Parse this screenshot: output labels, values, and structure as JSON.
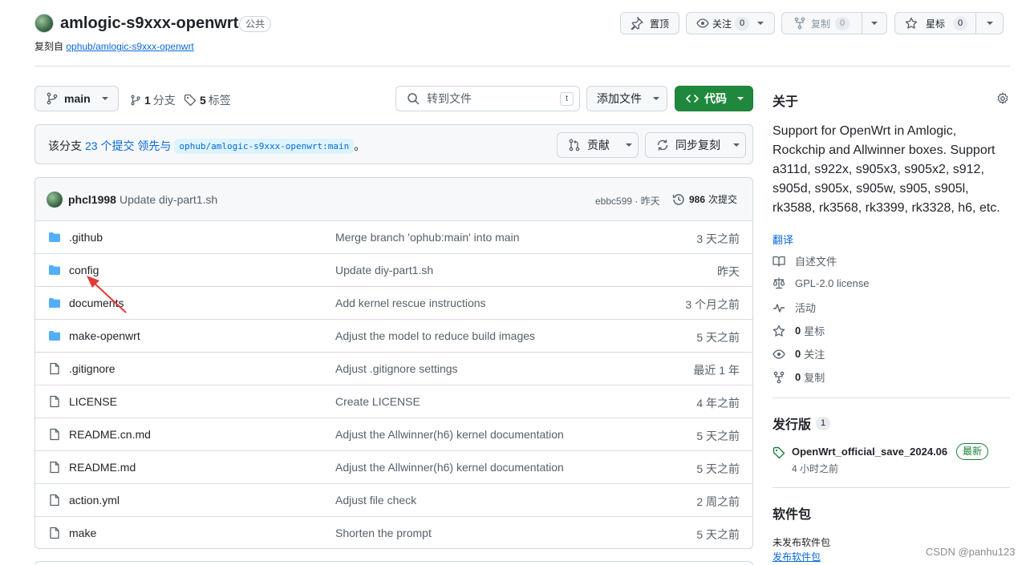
{
  "repo": {
    "name": "amlogic-s9xxx-openwrt",
    "visibility": "公共",
    "forked_prefix": "复刻自",
    "forked_from": "ophub/amlogic-s9xxx-openwrt"
  },
  "header_actions": {
    "pin_label": "置顶",
    "watch_label": "关注",
    "watch_count": "0",
    "fork_label": "复制",
    "fork_count": "0",
    "star_label": "星标",
    "star_count": "0"
  },
  "toolbar": {
    "branch": "main",
    "branches_count": "1",
    "branches_label": "分支",
    "tags_count": "5",
    "tags_label": "标签",
    "search_placeholder": "转到文件",
    "search_shortcut": "t",
    "add_file_label": "添加文件",
    "code_label": "代码"
  },
  "branch_status": {
    "prefix": "该分支",
    "ahead_link": "23 个提交 领先与",
    "upstream_ref": "ophub/amlogic-s9xxx-openwrt:main",
    "suffix": "。",
    "contribute_label": "贡献",
    "sync_label": "同步复刻"
  },
  "latest_commit": {
    "author": "phcl1998",
    "message": "Update diy-part1.sh",
    "hash_time": "ebbc599 · 昨天",
    "commits_count": "986",
    "commits_label": "次提交"
  },
  "files": [
    {
      "type": "folder",
      "name": ".github",
      "message": "Merge branch 'ophub:main' into main",
      "time": "3 天之前"
    },
    {
      "type": "folder",
      "name": "config",
      "message": "Update diy-part1.sh",
      "time": "昨天"
    },
    {
      "type": "folder",
      "name": "documents",
      "message": "Add kernel rescue instructions",
      "time": "3 个月之前"
    },
    {
      "type": "folder",
      "name": "make-openwrt",
      "message": "Adjust the model to reduce build images",
      "time": "5 天之前"
    },
    {
      "type": "file",
      "name": ".gitignore",
      "message": "Adjust .gitignore settings",
      "time": "最近 1 年"
    },
    {
      "type": "file",
      "name": "LICENSE",
      "message": "Create LICENSE",
      "time": "4 年之前"
    },
    {
      "type": "file",
      "name": "README.cn.md",
      "message": "Adjust the Allwinner(h6) kernel documentation",
      "time": "5 天之前"
    },
    {
      "type": "file",
      "name": "README.md",
      "message": "Adjust the Allwinner(h6) kernel documentation",
      "time": "5 天之前"
    },
    {
      "type": "file",
      "name": "action.yml",
      "message": "Adjust file check",
      "time": "2 周之前"
    },
    {
      "type": "file",
      "name": "make",
      "message": "Shorten the prompt",
      "time": "5 天之前"
    }
  ],
  "about": {
    "title": "关于",
    "description": "Support for OpenWrt in Amlogic, Rockchip and Allwinner boxes. Support a311d, s922x, s905x3, s905x2, s912, s905d, s905x, s905w, s905, s905l, rk3588, rk3568, rk3399, rk3328, h6, etc.",
    "translate_link": "翻译",
    "readme_label": "自述文件",
    "license_label": "GPL-2.0 license",
    "activity_label": "活动",
    "stars_count": "0",
    "stars_label": "星标",
    "watchers_count": "0",
    "watchers_label": "关注",
    "forks_count": "0",
    "forks_label": "复制"
  },
  "releases": {
    "title": "发行版",
    "count": "1",
    "latest_name": "OpenWrt_official_save_2024.06",
    "latest_badge": "最新",
    "latest_time": "4 小时之前"
  },
  "packages": {
    "title": "软件包",
    "empty_text": "未发布软件包",
    "publish_link": "发布软件包"
  },
  "watermark": "CSDN @panhu123",
  "colors": {
    "link": "#0969da",
    "primary_button": "#1f883d",
    "folder_icon": "#54aeff",
    "annotation_arrow": "#e53935"
  }
}
